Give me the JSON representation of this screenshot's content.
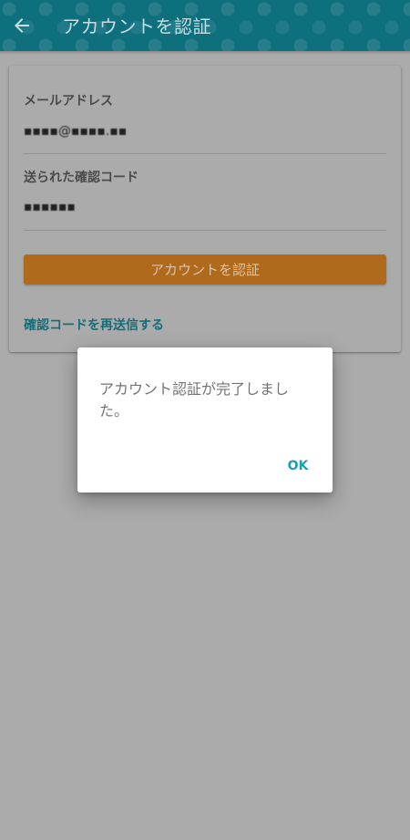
{
  "appbar": {
    "back_icon": "arrow-left-icon",
    "title": "アカウントを認証"
  },
  "form": {
    "email_label": "メールアドレス",
    "email_value": "▪▪▪▪@▪▪▪▪.▪▪",
    "code_label": "送られた確認コード",
    "code_value": "▪▪▪▪▪▪",
    "verify_button": "アカウントを認証",
    "resend_link": "確認コードを再送信する"
  },
  "dialog": {
    "message": "アカウント認証が完了しました。",
    "ok_button": "OK"
  },
  "colors": {
    "appbar": "#0e6f7d",
    "accent_button": "#b06a1c",
    "link": "#166d79",
    "dialog_ok": "#16a1b4",
    "scrim_background": "#ababab"
  }
}
